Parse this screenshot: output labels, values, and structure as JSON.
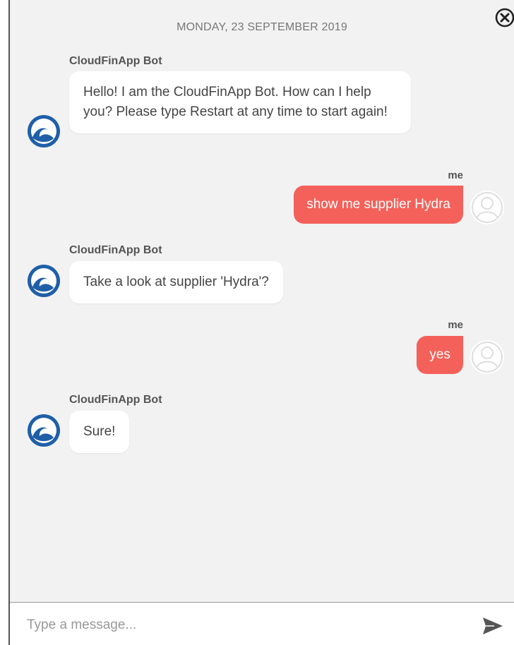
{
  "chat": {
    "date_header": "MONDAY, 23 SEPTEMBER 2019",
    "close_icon": "close-circle-icon",
    "messages": [
      {
        "from": "bot",
        "sender": "CloudFinApp Bot",
        "text": "Hello! I am the CloudFinApp Bot. How can I help you? Please type Restart at any time to start again!"
      },
      {
        "from": "user",
        "sender": "me",
        "text": "show me supplier Hydra"
      },
      {
        "from": "bot",
        "sender": "CloudFinApp Bot",
        "text": "Take a look at supplier 'Hydra'?"
      },
      {
        "from": "user",
        "sender": "me",
        "text": "yes"
      },
      {
        "from": "bot",
        "sender": "CloudFinApp Bot",
        "text": "Sure!"
      }
    ]
  },
  "composer": {
    "placeholder": "Type a message...",
    "value": "",
    "send_icon": "send-icon"
  },
  "colors": {
    "user_bubble": "#f4615a",
    "bot_bubble": "#ffffff",
    "background": "#f2f2f2",
    "bot_avatar": "#1f5fa8"
  }
}
